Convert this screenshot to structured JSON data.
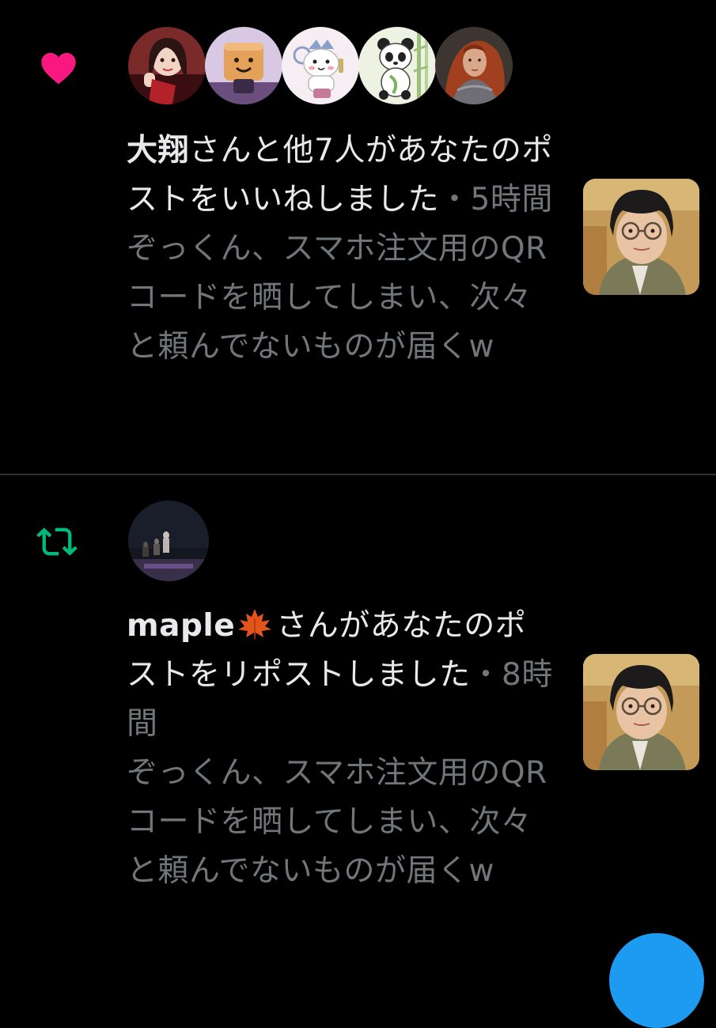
{
  "colors": {
    "background": "#000000",
    "divider": "#2f3336",
    "primary_text": "#e7e9ea",
    "secondary_text": "#71767b",
    "like_pink": "#f91880",
    "repost_green": "#00ba7c",
    "fab_blue": "#1d9bf0"
  },
  "notifications": [
    {
      "type": "like",
      "icon": "heart-icon",
      "avatars": [
        "avatar-idol",
        "avatar-tofu-character",
        "avatar-cat-character",
        "avatar-panda-character",
        "avatar-warrior-woman"
      ],
      "actor": "大翔",
      "action": "さんと他7人があなたのポストをいいねしました",
      "time_separator": "・",
      "time": "5時間",
      "snippet": "ぞっくん、スマホ注文用のQRコードを晒してしまい、次々と頼んでないものが届くw"
    },
    {
      "type": "repost",
      "icon": "repost-icon",
      "avatars": [
        "avatar-night-scene"
      ],
      "actor": "maple",
      "actor_emoji": "maple-leaf-emoji",
      "action": "さんがあなたのポストをリポストしました",
      "time_separator": "・",
      "time": "8時間",
      "snippet": "ぞっくん、スマホ注文用のQRコードを晒してしまい、次々と頼んでないものが届くw"
    }
  ]
}
